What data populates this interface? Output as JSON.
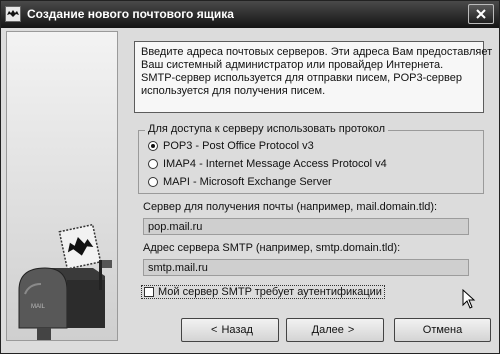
{
  "window": {
    "title": "Создание нового почтового ящика",
    "close_glyph": "✕"
  },
  "info_text": [
    "Введите адреса почтовых серверов. Эти адреса Вам предоставляет",
    "Ваш системный администратор или провайдер Интернета.",
    "SMTP-сервер используется для отправки писем, POP3-сервер",
    "используется для получения писем."
  ],
  "protocol_group": {
    "legend": "Для доступа к серверу использовать протокол",
    "options": [
      {
        "label": "POP3 - Post Office Protocol v3",
        "checked": true
      },
      {
        "label": "IMAP4 - Internet Message Access Protocol v4",
        "checked": false
      },
      {
        "label": "MAPI - Microsoft Exchange Server",
        "checked": false
      }
    ]
  },
  "incoming": {
    "label": "Сервер для получения почты  (например, mail.domain.tld):",
    "value": "pop.mail.ru"
  },
  "smtp": {
    "label": "Адрес сервера SMTP (например, smtp.domain.tld):",
    "value": "smtp.mail.ru"
  },
  "auth_checkbox": {
    "label": "Мой сервер SMTP требует аутентификации",
    "checked": false
  },
  "buttons": {
    "back": "Назад",
    "next": "Далее",
    "cancel": "Отмена",
    "back_arrow": "<",
    "next_arrow": ">"
  },
  "icons": {
    "app": "bat-mail-icon",
    "side": "mailbox-icon",
    "cursor": "mouse-cursor-icon"
  }
}
